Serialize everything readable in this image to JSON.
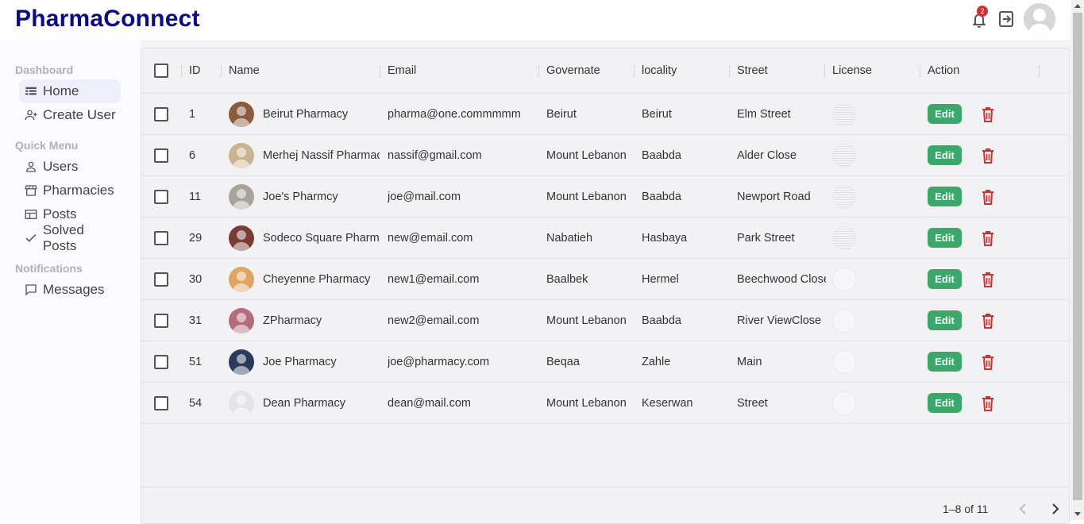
{
  "app": {
    "title": "PharmaConnect",
    "notification_count": "2"
  },
  "sidebar": {
    "sections": [
      {
        "label": "Dashboard",
        "items": [
          {
            "label": "Home",
            "icon": "dashboard-icon",
            "active": true
          },
          {
            "label": "Create User",
            "icon": "person-add-icon"
          }
        ]
      },
      {
        "label": "Quick Menu",
        "items": [
          {
            "label": "Users",
            "icon": "person-icon"
          },
          {
            "label": "Pharmacies",
            "icon": "store-icon"
          },
          {
            "label": "Posts",
            "icon": "table-icon"
          },
          {
            "label": "Solved Posts",
            "icon": "check-icon"
          }
        ]
      },
      {
        "label": "Notifications",
        "items": [
          {
            "label": "Messages",
            "icon": "chat-icon"
          }
        ]
      }
    ]
  },
  "table": {
    "columns": [
      "ID",
      "Name",
      "Email",
      "Governate",
      "locality",
      "Street",
      "License",
      "Action"
    ],
    "rows": [
      {
        "id": "1",
        "name": "Beirut Pharmacy",
        "email": "pharma@one.commmmm",
        "governate": "Beirut",
        "locality": "Beirut",
        "street": "Elm Street",
        "license": "lines",
        "avatar_color": "#8a5a3c"
      },
      {
        "id": "6",
        "name": "Merhej Nassif Pharmacy",
        "email": "nassif@gmail.com",
        "governate": "Mount Lebanon",
        "locality": "Baabda",
        "street": "Alder Close",
        "license": "lines",
        "avatar_color": "#c9b48f"
      },
      {
        "id": "11",
        "name": "Joe's Pharmcy",
        "email": "joe@mail.com",
        "governate": "Mount Lebanon",
        "locality": "Baabda",
        "street": "Newport Road",
        "license": "lines",
        "avatar_color": "#a7a29a"
      },
      {
        "id": "29",
        "name": "Sodeco Square Pharmacy",
        "email": "new@email.com",
        "governate": "Nabatieh",
        "locality": "Hasbaya",
        "street": "Park Street",
        "license": "lines",
        "avatar_color": "#7a3b33"
      },
      {
        "id": "30",
        "name": "Cheyenne Pharmacy",
        "email": "new1@email.com",
        "governate": "Baalbek",
        "locality": "Hermel",
        "street": "Beechwood Close",
        "license": "blank",
        "avatar_color": "#e0a560"
      },
      {
        "id": "31",
        "name": "ZPharmacy",
        "email": "new2@email.com",
        "governate": "Mount Lebanon",
        "locality": "Baabda",
        "street": "River ViewClose",
        "license": "blank",
        "avatar_color": "#b46b7a"
      },
      {
        "id": "51",
        "name": "Joe Pharmacy",
        "email": "joe@pharmacy.com",
        "governate": "Beqaa",
        "locality": "Zahle",
        "street": "Main",
        "license": "blank",
        "avatar_color": "#2b3a5a"
      },
      {
        "id": "54",
        "name": "Dean Pharmacy",
        "email": "dean@mail.com",
        "governate": "Mount Lebanon",
        "locality": "Keserwan",
        "street": "Street",
        "license": "blank",
        "avatar_color": "#e4e4e4"
      }
    ],
    "edit_label": "Edit"
  },
  "pagination": {
    "text": "1–8 of 11"
  },
  "colors": {
    "brand": "#0b0b8c",
    "edit_button": "#3aa86a",
    "delete_icon": "#d32f2f"
  }
}
